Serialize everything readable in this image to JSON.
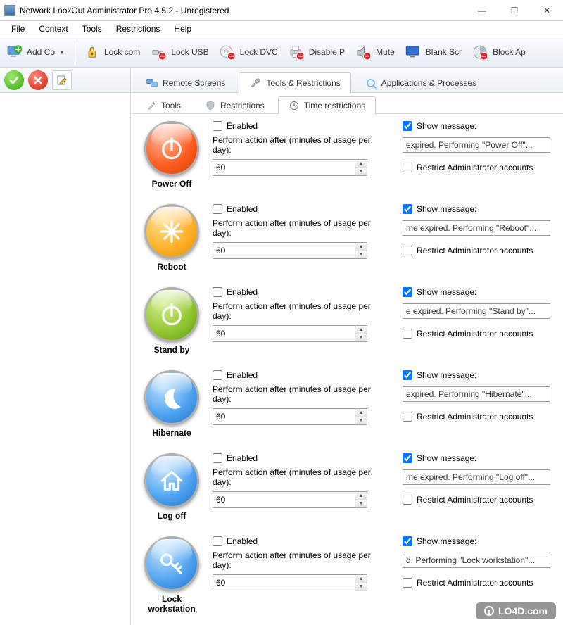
{
  "window": {
    "title": "Network LookOut Administrator Pro 4.5.2 - Unregistered",
    "minimize": "—",
    "maximize": "☐",
    "close": "✕"
  },
  "menubar": [
    "File",
    "Context",
    "Tools",
    "Restrictions",
    "Help"
  ],
  "toolbar": [
    {
      "key": "add-computer",
      "label": "Add Co",
      "dropdown": true
    },
    {
      "key": "lock-computer",
      "label": "Lock com"
    },
    {
      "key": "lock-usb",
      "label": "Lock USB"
    },
    {
      "key": "lock-dvd",
      "label": "Lock DVC"
    },
    {
      "key": "disable-print",
      "label": "Disable P"
    },
    {
      "key": "mute",
      "label": "Mute"
    },
    {
      "key": "blank-screen",
      "label": "Blank Scr"
    },
    {
      "key": "block-apps",
      "label": "Block Ap"
    }
  ],
  "main_tabs": [
    {
      "key": "remote-screens",
      "label": "Remote Screens",
      "active": false
    },
    {
      "key": "tools-restrictions",
      "label": "Tools & Restrictions",
      "active": true
    },
    {
      "key": "apps-processes",
      "label": "Applications & Processes",
      "active": false
    }
  ],
  "sub_tabs": [
    {
      "key": "tools",
      "label": "Tools",
      "active": false
    },
    {
      "key": "restrictions",
      "label": "Restrictions",
      "active": false
    },
    {
      "key": "time-restrictions",
      "label": "Time restrictions",
      "active": true
    }
  ],
  "labels": {
    "enabled": "Enabled",
    "perform_action": "Perform action after (minutes of usage per day):",
    "show_message": "Show message:",
    "restrict_admin": "Restrict Administrator accounts"
  },
  "actions": [
    {
      "key": "power-off",
      "title": "Power Off",
      "color": "red",
      "glyph": "power",
      "enabled": false,
      "minutes": "60",
      "show_msg": true,
      "msg": "expired. Performing \"Power Off\"...",
      "restrict_admin": false
    },
    {
      "key": "reboot",
      "title": "Reboot",
      "color": "orange",
      "glyph": "reboot",
      "enabled": false,
      "minutes": "60",
      "show_msg": true,
      "msg": "me expired. Performing \"Reboot\"...",
      "restrict_admin": false
    },
    {
      "key": "standby",
      "title": "Stand by",
      "color": "green",
      "glyph": "power",
      "enabled": false,
      "minutes": "60",
      "show_msg": true,
      "msg": "e expired. Performing \"Stand by\"...",
      "restrict_admin": false
    },
    {
      "key": "hibernate",
      "title": "Hibernate",
      "color": "blue",
      "glyph": "moon",
      "enabled": false,
      "minutes": "60",
      "show_msg": true,
      "msg": "expired. Performing \"Hibernate\"...",
      "restrict_admin": false
    },
    {
      "key": "logoff",
      "title": "Log off",
      "color": "blue",
      "glyph": "house",
      "enabled": false,
      "minutes": "60",
      "show_msg": true,
      "msg": "me expired. Performing \"Log off\"...",
      "restrict_admin": false
    },
    {
      "key": "lock-workstation",
      "title": "Lock workstation",
      "color": "blue",
      "glyph": "key",
      "enabled": false,
      "minutes": "60",
      "show_msg": true,
      "msg": "d. Performing \"Lock workstation\"...",
      "restrict_admin": false
    }
  ],
  "watermark": "LO4D.com"
}
